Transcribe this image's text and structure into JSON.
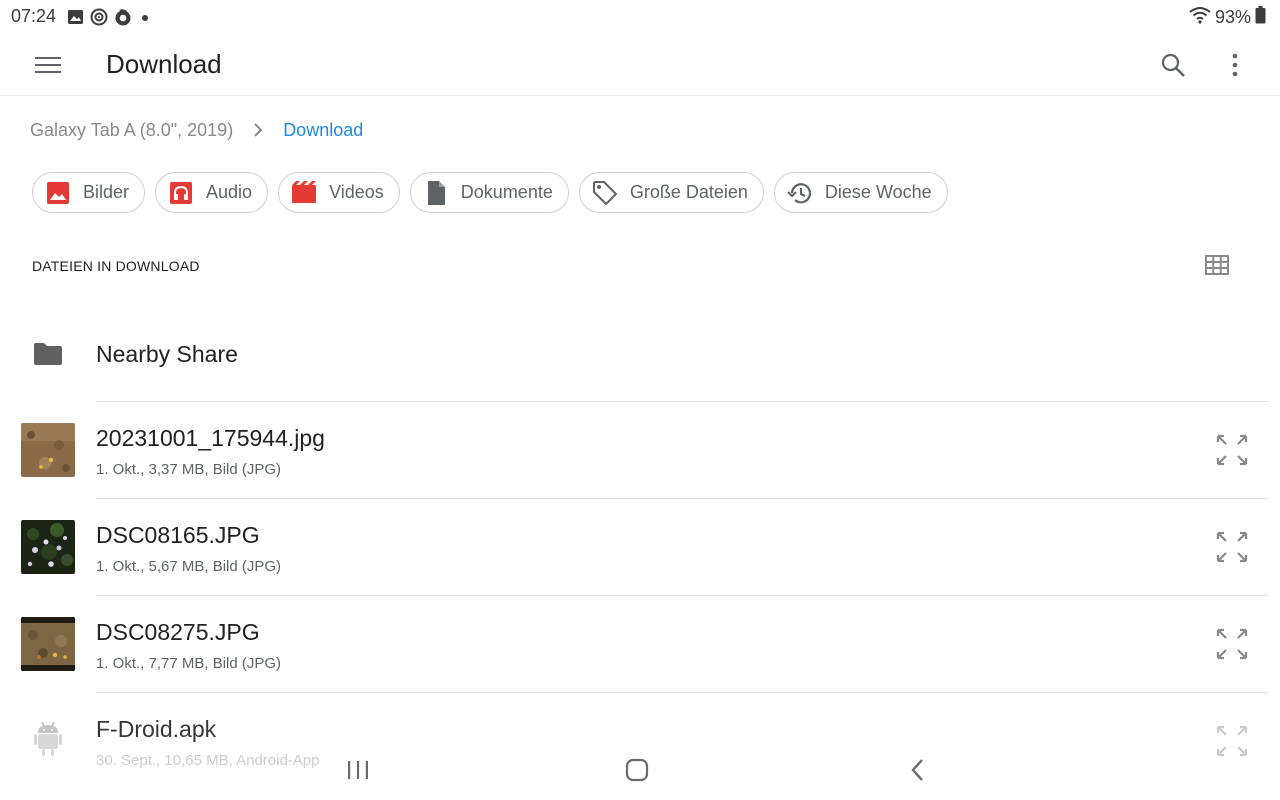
{
  "status_bar": {
    "time": "07:24",
    "battery": "93%",
    "icons": [
      "image-notification-icon",
      "sync-notification-icon",
      "firefox-notification-icon",
      "dot-icon",
      "wifi-icon",
      "battery-icon"
    ]
  },
  "toolbar": {
    "title": "Download",
    "menu_icon": "hamburger-menu-icon",
    "search_icon": "search-icon",
    "more_icon": "more-vert-icon"
  },
  "breadcrumb": {
    "root": "Galaxy Tab A (8.0\", 2019)",
    "current": "Download"
  },
  "chips": [
    {
      "label": "Bilder",
      "icon": "image-icon",
      "color": "#e53935"
    },
    {
      "label": "Audio",
      "icon": "headphones-icon",
      "color": "#e53935"
    },
    {
      "label": "Videos",
      "icon": "movie-icon",
      "color": "#e53935"
    },
    {
      "label": "Dokumente",
      "icon": "document-icon",
      "color": "#5f6368"
    },
    {
      "label": "Große Dateien",
      "icon": "tag-icon",
      "color": "#5f6368"
    },
    {
      "label": "Diese Woche",
      "icon": "history-icon",
      "color": "#5f6368"
    }
  ],
  "section": {
    "title": "DATEIEN IN DOWNLOAD",
    "view_icon": "grid-view-icon"
  },
  "files": [
    {
      "name": "Nearby Share",
      "meta": "",
      "icon": "folder-icon"
    },
    {
      "name": "20231001_175944.jpg",
      "meta": "1. Okt., 3,37 MB, Bild (JPG)",
      "icon": "image-thumbnail"
    },
    {
      "name": "DSC08165.JPG",
      "meta": "1. Okt., 5,67 MB, Bild (JPG)",
      "icon": "image-thumbnail"
    },
    {
      "name": "DSC08275.JPG",
      "meta": "1. Okt., 7,77 MB, Bild (JPG)",
      "icon": "image-thumbnail"
    },
    {
      "name": "F-Droid.apk",
      "meta": "30. Sept., 10,65 MB, Android-App",
      "icon": "android-icon"
    }
  ],
  "colors": {
    "accent": "#1e88e5",
    "chip_red": "#e53935",
    "icon_grey": "#5f6368"
  }
}
